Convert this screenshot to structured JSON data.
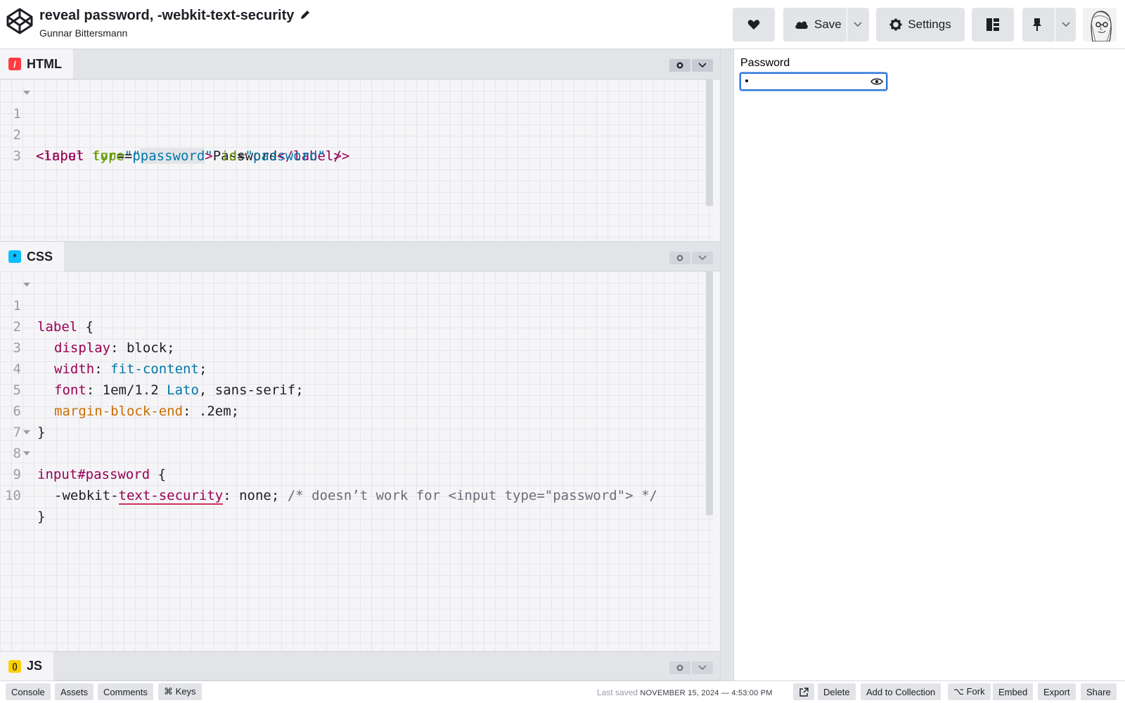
{
  "header": {
    "pen_title": "reveal password, -webkit-text-security",
    "author": "Gunnar Bittersmann",
    "save_label": "Save",
    "settings_label": "Settings"
  },
  "panes": {
    "html": {
      "label": "HTML",
      "badge": "/",
      "badge_color": "#ff3c41",
      "line_numbers": [
        "1",
        "2",
        "3"
      ],
      "lines": [
        [
          "<",
          "label",
          " ",
          "for",
          "=",
          "\"password\"",
          ">",
          "Password",
          "</",
          "label",
          ">"
        ],
        [
          "<",
          "input",
          " ",
          "type",
          "=",
          "\"",
          "password",
          "\"",
          " ",
          "id",
          "=",
          "\"password\"",
          " />"
        ]
      ]
    },
    "css": {
      "label": "CSS",
      "badge": "*",
      "badge_color": "#0ebeff",
      "line_numbers": [
        "1",
        "2",
        "3",
        "4",
        "5",
        "6",
        "7",
        "8",
        "9",
        "10"
      ],
      "lines": [
        [
          "label",
          " {"
        ],
        [
          "display",
          ": block;"
        ],
        [
          "width",
          ": ",
          "fit-content",
          ";"
        ],
        [
          "font",
          ": 1em/1.2 ",
          "Lato",
          ", sans-serif;"
        ],
        [
          "margin-block-end",
          ": .2em;"
        ],
        [
          "}"
        ],
        [],
        [
          "input#password",
          " {"
        ],
        [
          "-webkit-",
          "text-security",
          ": none; ",
          "/* doesn’t work for <input type=\"password\"> */"
        ],
        [
          "}"
        ]
      ]
    },
    "js": {
      "label": "JS",
      "badge": "()",
      "badge_color": "#fcd000"
    }
  },
  "preview": {
    "label": "Password",
    "input_type": "password"
  },
  "footer": {
    "left_buttons": [
      "Console",
      "Assets",
      "Comments",
      "⌘ Keys"
    ],
    "last_saved_label": "Last saved",
    "last_saved_value": "NOVEMBER 15, 2024 — 4:53:00 PM",
    "delete": "Delete",
    "add_to_collection": "Add to Collection",
    "fork": "⌥ Fork",
    "embed": "Embed",
    "export": "Export",
    "share": "Share"
  },
  "colors": {
    "accent": "#2f74d8",
    "tag": "#990055",
    "attr": "#669900",
    "string": "#0077aa",
    "important_prop": "#cc6d00"
  },
  "icons": [
    "codepen-logo-icon",
    "pencil-icon",
    "heart-icon",
    "cloud-icon",
    "chevron-down-icon",
    "gear-icon",
    "layout-icon",
    "pin-icon",
    "eye-icon",
    "external-link-icon"
  ]
}
